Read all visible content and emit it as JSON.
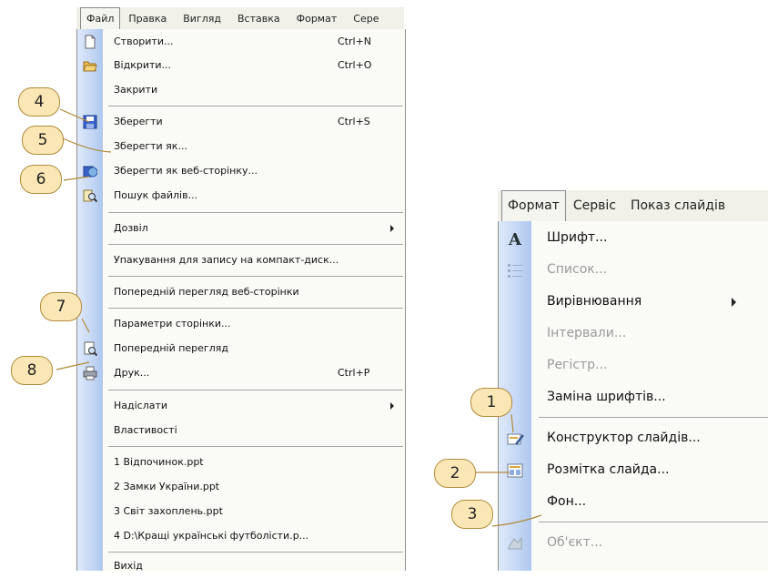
{
  "file_menu": {
    "menubar": [
      "Файл",
      "Правка",
      "Вигляд",
      "Вставка",
      "Формат",
      "Сере"
    ],
    "items": [
      {
        "label": "Створити...",
        "shortcut": "Ctrl+N",
        "icon": "new-document-icon"
      },
      {
        "label": "Відкрити...",
        "shortcut": "Ctrl+O",
        "icon": "open-folder-icon"
      },
      {
        "label": "Закрити",
        "shortcut": "",
        "icon": ""
      },
      {
        "label": "Зберегти",
        "shortcut": "Ctrl+S",
        "icon": "save-disk-icon"
      },
      {
        "label": "Зберегти як...",
        "shortcut": "",
        "icon": ""
      },
      {
        "label": "Зберегти як веб-сторінку...",
        "shortcut": "",
        "icon": "save-as-web-icon"
      },
      {
        "label": "Пошук файлів...",
        "shortcut": "",
        "icon": "file-search-icon"
      },
      {
        "label": "Дозвіл",
        "shortcut": "",
        "icon": "",
        "submenu": true
      },
      {
        "label": "Упакування для запису на компакт-диск...",
        "shortcut": "",
        "icon": ""
      },
      {
        "label": "Попередній перегляд веб-сторінки",
        "shortcut": "",
        "icon": ""
      },
      {
        "label": "Параметри сторінки...",
        "shortcut": "",
        "icon": ""
      },
      {
        "label": "Попередній перегляд",
        "shortcut": "",
        "icon": "print-preview-icon"
      },
      {
        "label": "Друк...",
        "shortcut": "Ctrl+P",
        "icon": "printer-icon"
      },
      {
        "label": "Надіслати",
        "shortcut": "",
        "icon": "",
        "submenu": true
      },
      {
        "label": "Властивості",
        "shortcut": "",
        "icon": ""
      },
      {
        "label": "1 Відпочинок.ppt",
        "shortcut": "",
        "icon": ""
      },
      {
        "label": "2 Замки України.ppt",
        "shortcut": "",
        "icon": ""
      },
      {
        "label": "3 Світ захоплень.ppt",
        "shortcut": "",
        "icon": ""
      },
      {
        "label": "4 D:\\Кращі українські футболісти.p...",
        "shortcut": "",
        "icon": ""
      },
      {
        "label": "Вихід",
        "shortcut": "",
        "icon": ""
      }
    ]
  },
  "format_menu": {
    "menubar": [
      "Формат",
      "Сервіс",
      "Показ слайдів"
    ],
    "items": [
      {
        "label": "Шрифт...",
        "enabled": true,
        "icon": "font-a-icon"
      },
      {
        "label": "Список...",
        "enabled": false,
        "icon": "bulleted-list-icon"
      },
      {
        "label": "Вирівнювання",
        "enabled": true,
        "icon": "",
        "submenu": true
      },
      {
        "label": "Інтервали...",
        "enabled": false,
        "icon": ""
      },
      {
        "label": "Регістр...",
        "enabled": false,
        "icon": ""
      },
      {
        "label": "Заміна шрифтів...",
        "enabled": true,
        "icon": ""
      },
      {
        "label": "Конструктор слайдів...",
        "enabled": true,
        "icon": "slide-design-icon"
      },
      {
        "label": "Розмітка слайда...",
        "enabled": true,
        "icon": "slide-layout-icon"
      },
      {
        "label": "Фон...",
        "enabled": true,
        "icon": ""
      },
      {
        "label": "Об'єкт...",
        "enabled": false,
        "icon": "object-icon"
      }
    ]
  },
  "callouts": [
    "1",
    "2",
    "3",
    "4",
    "5",
    "6",
    "7",
    "8"
  ],
  "colors": {
    "callout_fill": "#fbe7b6",
    "callout_border": "#b08a3a",
    "gutter": "#c3d6f4"
  }
}
